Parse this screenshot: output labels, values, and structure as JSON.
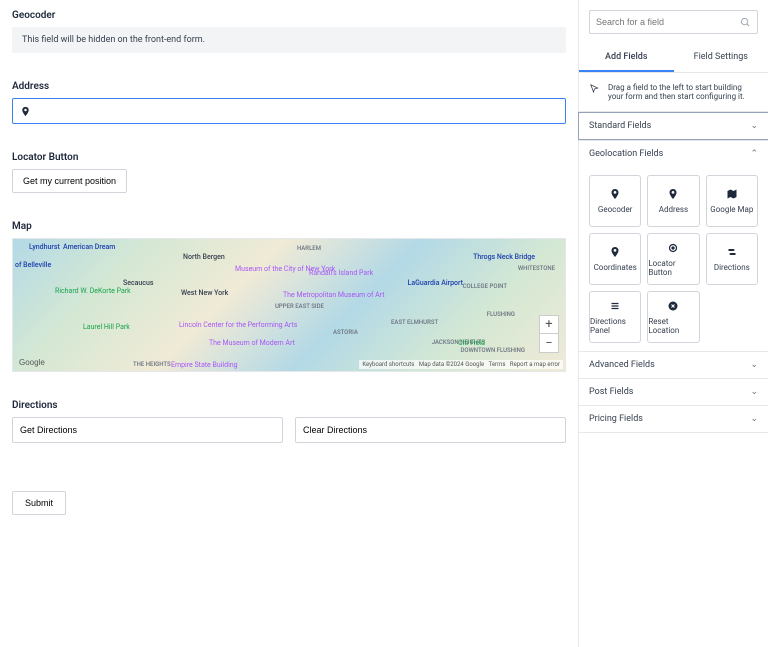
{
  "main": {
    "geocoder": {
      "title": "Geocoder",
      "notice": "This field will be hidden on the front-end form."
    },
    "address": {
      "title": "Address"
    },
    "locator": {
      "title": "Locator Button",
      "button": "Get my current position"
    },
    "map": {
      "title": "Map",
      "labels": {
        "lyndhurst": "Lyndhurst",
        "belleville": "of Belleville",
        "northbergen": "North Bergen",
        "secaucus": "Secaucus",
        "westny": "West New York",
        "harlem": "HARLEM",
        "collegepoint": "COLLEGE POINT",
        "whitestone": "WHITESTONE",
        "astoria": "ASTORIA",
        "heights": "THE HEIGHTS",
        "elmhurst": "EAST ELMHURST",
        "americandream": "American Dream",
        "throgs": "Throgs Neck Bridge",
        "laguardia": "LaGuardia Airport",
        "upperside": "UPPER EAST SIDE",
        "flushing": "FLUSHING",
        "jackson": "JACKSON HEIGHTS",
        "downtown": "DOWNTOWN FLUSHING"
      },
      "pois": {
        "museumcity": "Museum of the City of New York",
        "randalls": "Randall's Island Park",
        "metmuseum": "The Metropolitan Museum of Art",
        "lincoln": "Lincoln Center for the Performing Arts",
        "modernart": "The Museum of Modern Art",
        "empire": "Empire State Building",
        "dekorte": "Richard W. DeKorte Park",
        "laurelhill": "Laurel Hill Park",
        "citifield": "Citi Field"
      },
      "attrib": {
        "shortcuts": "Keyboard shortcuts",
        "mapdata": "Map data ©2024 Google",
        "terms": "Terms",
        "report": "Report a map error"
      },
      "googleLogo": "Google"
    },
    "directions": {
      "title": "Directions",
      "get": "Get Directions",
      "clear": "Clear Directions"
    },
    "submit": "Submit"
  },
  "sidebar": {
    "search": {
      "placeholder": "Search for a field"
    },
    "tabs": {
      "add": "Add Fields",
      "settings": "Field Settings"
    },
    "dragHint": "Drag a field to the left to start building your form and then start configuring it.",
    "sections": {
      "standard": "Standard Fields",
      "geolocation": "Geolocation Fields",
      "advanced": "Advanced Fields",
      "post": "Post Fields",
      "pricing": "Pricing Fields"
    },
    "geoFields": {
      "geocoder": "Geocoder",
      "address": "Address",
      "googlemap": "Google Map",
      "coordinates": "Coordinates",
      "locatorbtn": "Locator Button",
      "directions": "Directions",
      "dirpanel": "Directions Panel",
      "resetloc": "Reset Location"
    }
  }
}
